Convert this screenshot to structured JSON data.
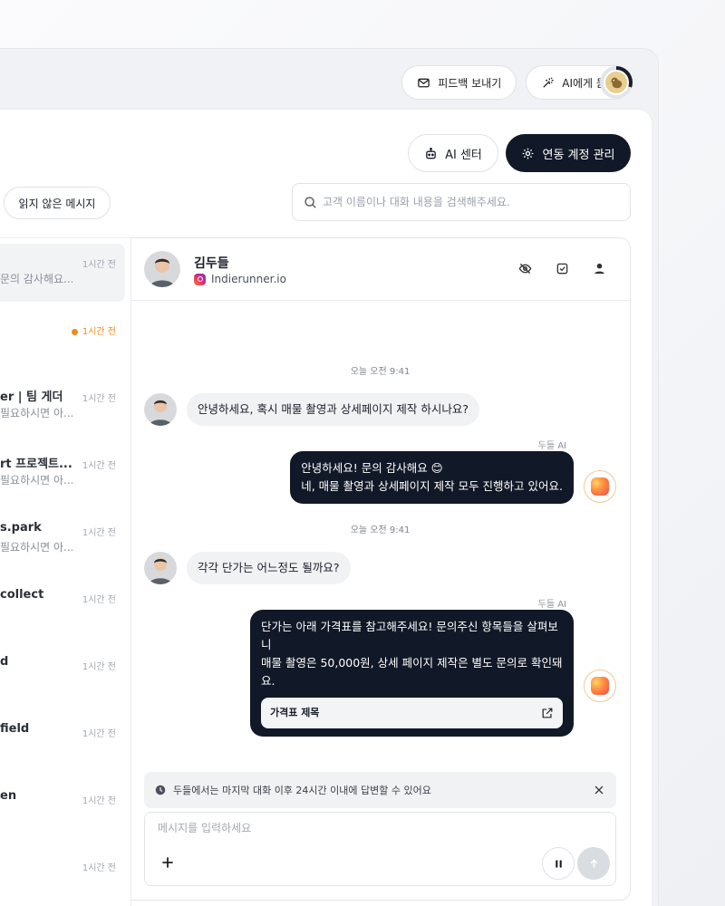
{
  "topbar": {
    "feedback_label": "피드백 보내기",
    "ask_ai_label": "AI에게 묻기"
  },
  "toolbar": {
    "ai_center_label": "AI 센터",
    "linked_accounts_label": "연동 계정 관리",
    "unread_filter_label": "읽지 않은 메시지"
  },
  "search": {
    "placeholder": "고객 이름이나 대화 내용을 검색해주세요."
  },
  "conversations": [
    {
      "name": "",
      "preview": "문의 감사해요...",
      "time": "1시간 전",
      "active": true,
      "unread": false
    },
    {
      "name": "",
      "preview": "",
      "time": "1시간 전",
      "active": false,
      "unread": true
    },
    {
      "name": "er | 팀 게더",
      "preview": "필요하시면 아...",
      "time": "1시간 전",
      "active": false,
      "unread": false
    },
    {
      "name": "rt 프로젝트...",
      "preview": "필요하시면 아...",
      "time": "1시간 전",
      "active": false,
      "unread": false
    },
    {
      "name": "s.park",
      "preview": "필요하시면 아...",
      "time": "1시간 전",
      "active": false,
      "unread": false
    },
    {
      "name": "collect",
      "preview": "",
      "time": "1시간 전",
      "active": false,
      "unread": false
    },
    {
      "name": "d",
      "preview": "",
      "time": "1시간 전",
      "active": false,
      "unread": false
    },
    {
      "name": "field",
      "preview": "",
      "time": "1시간 전",
      "active": false,
      "unread": false
    },
    {
      "name": "en",
      "preview": "",
      "time": "1시간 전",
      "active": false,
      "unread": false
    },
    {
      "name": "",
      "preview": "",
      "time": "1시간 전",
      "active": false,
      "unread": false
    }
  ],
  "chat": {
    "contact_name": "김두들",
    "contact_source": "Indierunner.io",
    "timestamp_1": "오늘 오전 9:41",
    "timestamp_2": "오늘 오전 9:41",
    "ai_label": "두들 AI",
    "msg_in_1": "안녕하세요, 혹시 매물 촬영과 상세페이지 제작 하시나요?",
    "msg_out_1_line1": "안녕하세요! 문의 감사해요 😊",
    "msg_out_1_line2": "네, 매물 촬영과 상세페이지 제작 모두 진행하고 있어요.",
    "msg_in_2": "각각 단가는 어느정도 될까요?",
    "msg_out_2_line1": "단가는 아래 가격표를 참고해주세요! 문의주신 항목들을 살펴보니",
    "msg_out_2_line2": "매물 촬영은 50,000원, 상세 페이지 제작은 별도 문의로 확인돼요.",
    "price_card_title": "가격표 제목",
    "notice": "두들에서는 마지막 대화 이후 24시간 이내에 답변할 수 있어요",
    "composer_placeholder": "메시지를 입력하세요"
  },
  "colors": {
    "primary_dark": "#111827",
    "unread_orange": "#ef8a1c"
  }
}
